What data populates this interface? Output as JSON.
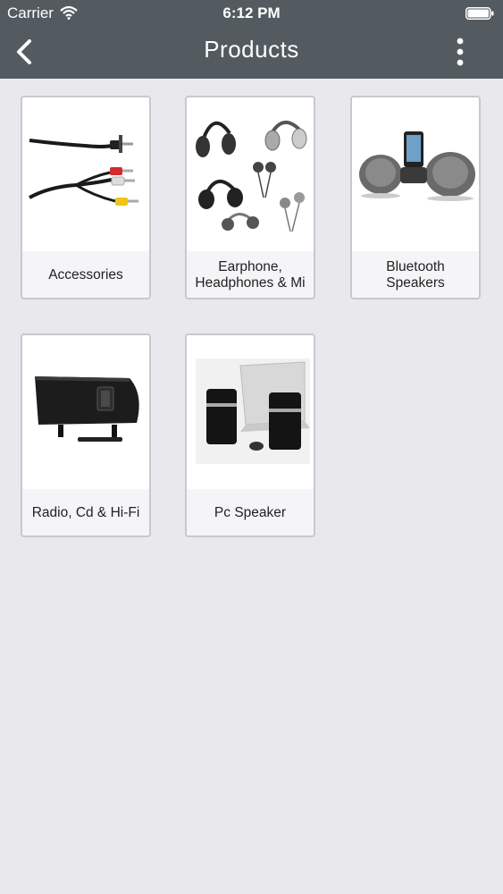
{
  "status_bar": {
    "carrier": "Carrier",
    "time": "6:12 PM",
    "icons": [
      "wifi-icon",
      "battery-icon"
    ]
  },
  "nav": {
    "title": "Products",
    "back_icon": "chevron-left-icon",
    "menu_icon": "more-vertical-icon"
  },
  "colors": {
    "nav_background": "#535b60",
    "page_background": "#e9e8ec",
    "card_background": "#f5f4f7",
    "card_border": "#c9c8cc"
  },
  "categories": [
    {
      "label": "Accessories",
      "image": "av-cable-image"
    },
    {
      "label": "Earphone, Headphones & Mi",
      "image": "headphones-image"
    },
    {
      "label": "Bluetooth Speakers",
      "image": "bluetooth-speakers-image"
    },
    {
      "label": "Radio, Cd & Hi-Fi",
      "image": "radio-hifi-image"
    },
    {
      "label": "Pc Speaker",
      "image": "pc-speaker-image"
    }
  ]
}
